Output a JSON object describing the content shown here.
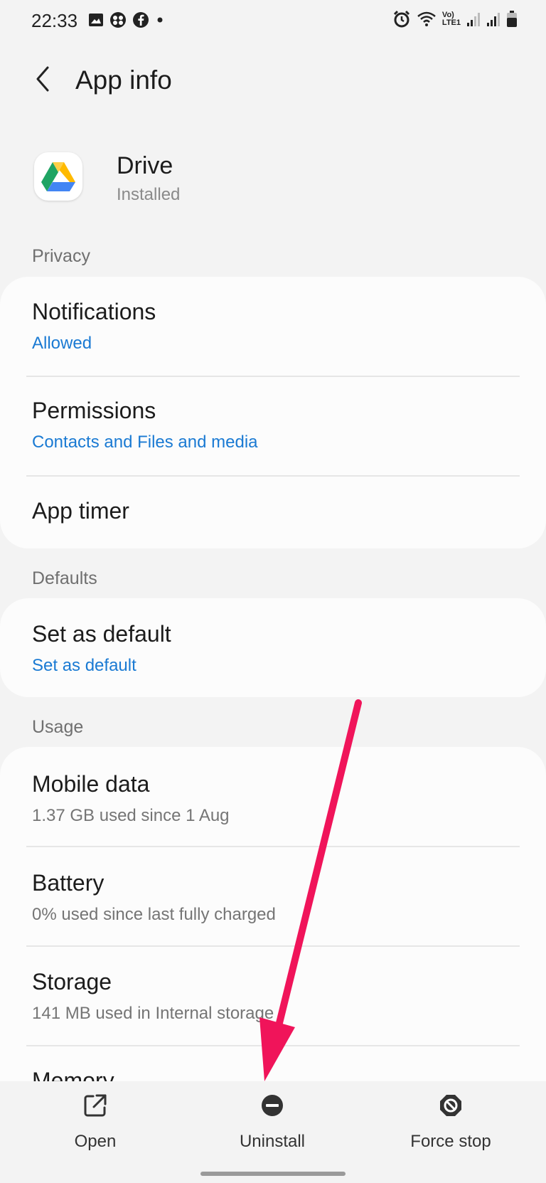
{
  "status_bar": {
    "time": "22:33",
    "left_icons": [
      "gallery-icon",
      "game-controller-icon",
      "facebook-icon",
      "dot-icon"
    ],
    "right_icons": [
      "alarm-icon",
      "wifi-icon",
      "volte-icon",
      "signal-icon",
      "signal-icon",
      "battery-icon"
    ],
    "volte_line1": "Vo)",
    "volte_line2": "LTE1"
  },
  "header": {
    "title": "App info",
    "back_icon": "chevron-left-icon"
  },
  "app": {
    "name": "Drive",
    "status": "Installed",
    "icon": "google-drive-icon",
    "colors": {
      "green": "#1fa463",
      "blue": "#4285f4",
      "yellow": "#ffba00"
    }
  },
  "sections": {
    "privacy": {
      "label": "Privacy",
      "items": [
        {
          "title": "Notifications",
          "subtitle": "Allowed"
        },
        {
          "title": "Permissions",
          "subtitle": "Contacts and Files and media"
        },
        {
          "title": "App timer"
        }
      ]
    },
    "defaults": {
      "label": "Defaults",
      "items": [
        {
          "title": "Set as default",
          "subtitle": "Set as default"
        }
      ]
    },
    "usage": {
      "label": "Usage",
      "items": [
        {
          "title": "Mobile data",
          "subtitle": "1.37 GB used since 1 Aug"
        },
        {
          "title": "Battery",
          "subtitle": "0% used since last fully charged"
        },
        {
          "title": "Storage",
          "subtitle": "141 MB used in Internal storage"
        },
        {
          "title": "Memory"
        }
      ]
    }
  },
  "bottom_actions": [
    {
      "label": "Open",
      "icon": "open-external-icon"
    },
    {
      "label": "Uninstall",
      "icon": "uninstall-icon"
    },
    {
      "label": "Force stop",
      "icon": "force-stop-icon"
    }
  ],
  "colors": {
    "accent_blue": "#1a7ad3",
    "annotation_arrow": "#f0145a",
    "background": "#f3f3f3",
    "card": "#fcfcfc"
  }
}
